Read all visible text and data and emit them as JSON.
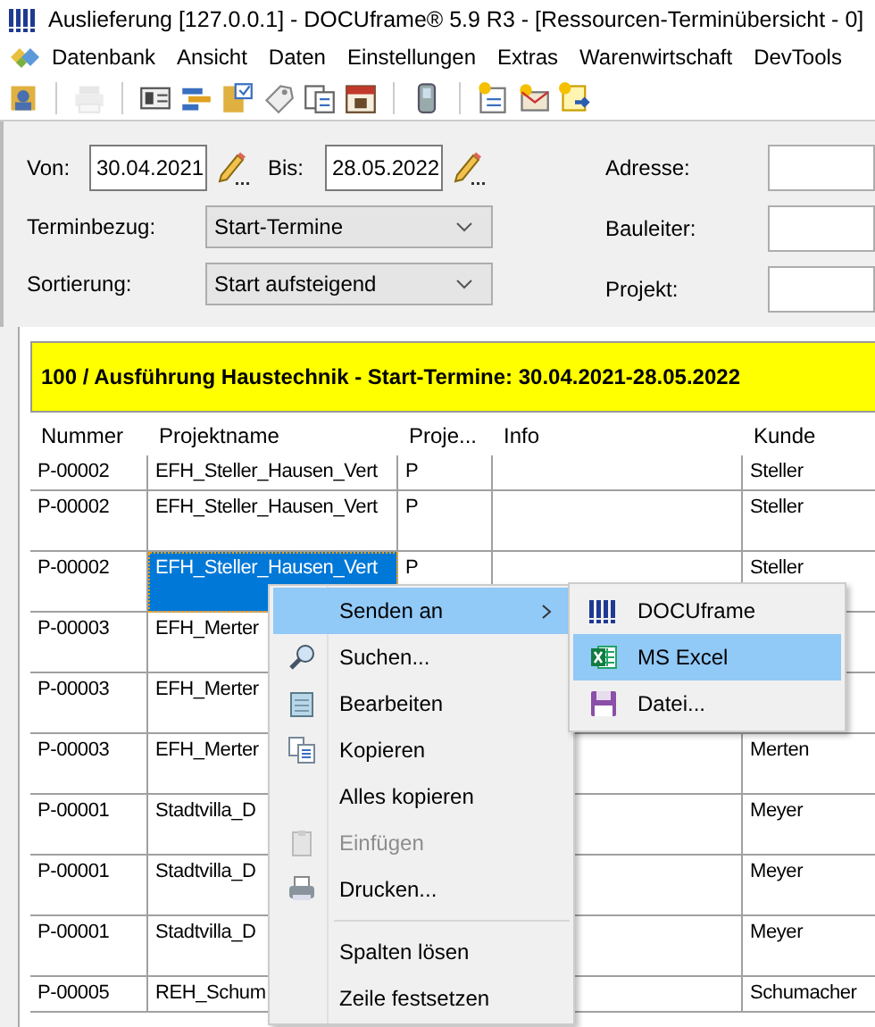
{
  "window": {
    "title": "Auslieferung [127.0.0.1] - DOCUframe® 5.9 R3 - [Ressourcen-Terminübersicht - 0]"
  },
  "menubar": [
    "Datenbank",
    "Ansicht",
    "Daten",
    "Einstellungen",
    "Extras",
    "Warenwirtschaft",
    "DevTools"
  ],
  "toolbar": [
    {
      "kind": "button",
      "disabled": false
    },
    {
      "kind": "separator"
    },
    {
      "kind": "button",
      "disabled": true
    },
    {
      "kind": "separator"
    },
    {
      "kind": "button",
      "disabled": false
    },
    {
      "kind": "button",
      "disabled": false
    },
    {
      "kind": "button",
      "disabled": false
    },
    {
      "kind": "button",
      "disabled": false
    },
    {
      "kind": "button",
      "disabled": false
    },
    {
      "kind": "button",
      "disabled": false
    },
    {
      "kind": "separator"
    },
    {
      "kind": "button",
      "disabled": false
    },
    {
      "kind": "separator"
    },
    {
      "kind": "button",
      "disabled": false
    },
    {
      "kind": "button",
      "disabled": false
    },
    {
      "kind": "button",
      "disabled": false
    }
  ],
  "filter": {
    "von": {
      "label": "Von:",
      "value": "30.04.2021"
    },
    "bis": {
      "label": "Bis:",
      "value": "28.05.2022"
    },
    "terminbezug": {
      "label": "Terminbezug:",
      "value": "Start-Termine"
    },
    "sortierung": {
      "label": "Sortierung:",
      "value": "Start aufsteigend"
    },
    "right_fields": [
      {
        "label": "Adresse:"
      },
      {
        "label": "Bauleiter:"
      },
      {
        "label": "Projekt:"
      }
    ]
  },
  "banner": "100 / Ausführung Haustechnik - Start-Termine: 30.04.2021-28.05.2022",
  "table": {
    "columns": [
      "Nummer",
      "Projektname",
      "Proje...",
      "Info",
      "Kunde"
    ],
    "rows": [
      {
        "kind": "short",
        "selected": false,
        "nummer": "P-00002",
        "projektname": "EFH_Steller_Hausen_Vert",
        "proje": "P",
        "kunde": "Steller"
      },
      {
        "kind": "tall",
        "selected": false,
        "nummer": "P-00002",
        "projektname": "EFH_Steller_Hausen_Vert",
        "proje": "P",
        "kunde": "Steller"
      },
      {
        "kind": "tall",
        "selected": true,
        "nummer": "P-00002",
        "projektname": "EFH_Steller_Hausen_Vert",
        "proje": "P",
        "kunde": "Steller"
      },
      {
        "kind": "tall",
        "selected": false,
        "nummer": "P-00003",
        "projektname": "EFH_Merter"
      },
      {
        "kind": "tall",
        "selected": false,
        "nummer": "P-00003",
        "projektname": "EFH_Merter"
      },
      {
        "kind": "tall",
        "selected": false,
        "nummer": "P-00003",
        "projektname": "EFH_Merter",
        "kunde": "Merten"
      },
      {
        "kind": "tall",
        "selected": false,
        "nummer": "P-00001",
        "projektname": "Stadtvilla_D",
        "kunde": "Meyer"
      },
      {
        "kind": "tall",
        "selected": false,
        "nummer": "P-00001",
        "projektname": "Stadtvilla_D",
        "kunde": "Meyer"
      },
      {
        "kind": "tall",
        "selected": false,
        "nummer": "P-00001",
        "projektname": "Stadtvilla_D",
        "kunde": "Meyer"
      },
      {
        "kind": "short",
        "selected": false,
        "nummer": "P-00005",
        "projektname": "REH_Schum",
        "kunde": "Schumacher"
      }
    ]
  },
  "context_menu": {
    "items": [
      {
        "kind": "item",
        "label": "Senden an",
        "selected": true,
        "submenu": true,
        "disabled": false
      },
      {
        "kind": "item",
        "label": "Suchen...",
        "selected": false,
        "submenu": false,
        "disabled": false
      },
      {
        "kind": "item",
        "label": "Bearbeiten",
        "selected": false,
        "submenu": false,
        "disabled": false
      },
      {
        "kind": "item",
        "label": "Kopieren",
        "selected": false,
        "submenu": false,
        "disabled": false
      },
      {
        "kind": "item",
        "label": "Alles kopieren",
        "selected": false,
        "submenu": false,
        "disabled": false
      },
      {
        "kind": "item",
        "label": "Einfügen",
        "selected": false,
        "submenu": false,
        "disabled": true
      },
      {
        "kind": "item",
        "label": "Drucken...",
        "selected": false,
        "submenu": false,
        "disabled": false
      },
      {
        "kind": "separator"
      },
      {
        "kind": "item",
        "label": "Spalten lösen",
        "selected": false,
        "submenu": false,
        "disabled": false
      },
      {
        "kind": "item",
        "label": "Zeile festsetzen",
        "selected": false,
        "submenu": false,
        "disabled": false
      }
    ],
    "submenu": [
      {
        "label": "DOCUframe",
        "selected": false
      },
      {
        "label": "MS Excel",
        "selected": true
      },
      {
        "label": "Datei...",
        "selected": false
      }
    ]
  }
}
